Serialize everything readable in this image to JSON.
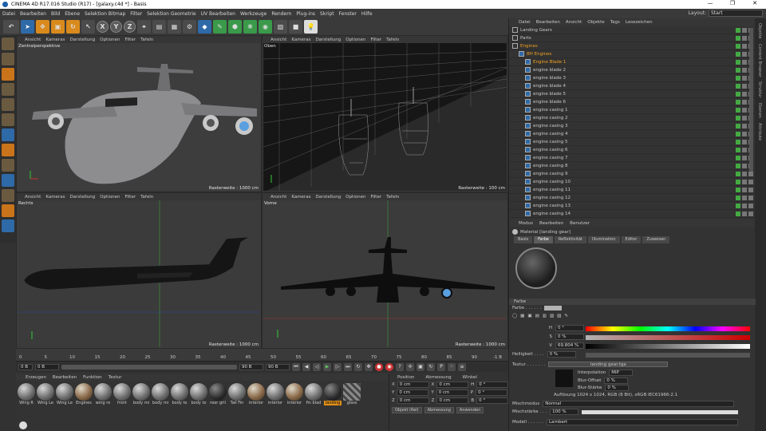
{
  "window": {
    "title": "CINEMA 4D R17.016 Studio (R17) - [galaxy.c4d *] - Basis"
  },
  "menu": [
    "Datei",
    "Bearbeiten",
    "Bild",
    "Ebene",
    "Selektion Bitmap",
    "Filter",
    "Selektion Geometrie",
    "UV Bearbeiten",
    "Werkzeuge",
    "Rendern",
    "Plug-ins",
    "Skript",
    "Fenster",
    "Hilfe"
  ],
  "layout": {
    "label": "Layout:",
    "value": "Start"
  },
  "toolbar": {
    "x": "X",
    "y": "Y",
    "z": "Z"
  },
  "viewport_menu": [
    "Ansicht",
    "Kameras",
    "Darstellung",
    "Optionen",
    "Filter",
    "Tafeln"
  ],
  "viewports": [
    {
      "label": "Zentralperspektive",
      "grid": "Rasterweite : 1000 cm"
    },
    {
      "label": "Oben",
      "grid": "Rasterweite : 100 cm"
    },
    {
      "label": "Rechts",
      "grid": "Rasterweite : 1000 cm"
    },
    {
      "label": "Vorne",
      "grid": "Rasterweite : 1000 cm"
    }
  ],
  "timeline": {
    "ticks": [
      "0",
      "5",
      "10",
      "15",
      "20",
      "25",
      "30",
      "35",
      "40",
      "45",
      "50",
      "55",
      "60",
      "65",
      "70",
      "75",
      "80",
      "85",
      "90"
    ],
    "end": "-1 B"
  },
  "playbar": {
    "start": "0 B",
    "start2": "0 B",
    "end": "90 B",
    "end2": "90 B"
  },
  "material_menu": [
    "Erzeugen",
    "Bearbeiten",
    "Funktion",
    "Textur"
  ],
  "materials": [
    {
      "name": "Wing R",
      "kind": "grey"
    },
    {
      "name": "Wing Le",
      "kind": "grey"
    },
    {
      "name": "Wing Le",
      "kind": "grey"
    },
    {
      "name": "Engines",
      "kind": "tex"
    },
    {
      "name": "wing ro",
      "kind": "grey"
    },
    {
      "name": "front",
      "kind": "grey"
    },
    {
      "name": "body mi",
      "kind": "grey"
    },
    {
      "name": "body mi",
      "kind": "grey"
    },
    {
      "name": "body to",
      "kind": "grey"
    },
    {
      "name": "body to",
      "kind": "grey"
    },
    {
      "name": "rear gril",
      "kind": "dark"
    },
    {
      "name": "Tail Fin",
      "kind": "grey"
    },
    {
      "name": "interior",
      "kind": "tex"
    },
    {
      "name": "interior",
      "kind": "grey"
    },
    {
      "name": "interior",
      "kind": "tex"
    },
    {
      "name": "fin blad",
      "kind": "grey"
    },
    {
      "name": "landing",
      "kind": "dark",
      "selected": true
    },
    {
      "name": "glass",
      "kind": "stripe"
    }
  ],
  "coords": {
    "headers": [
      "Position",
      "Abmessung",
      "Winkel"
    ],
    "rows": [
      [
        "X",
        "0 cm",
        "X",
        "0 cm",
        "H",
        "0 °"
      ],
      [
        "Y",
        "0 cm",
        "Y",
        "0 cm",
        "P",
        "0 °"
      ],
      [
        "Z",
        "0 cm",
        "Z",
        "0 cm",
        "B",
        "0 °"
      ]
    ],
    "mode1": "Objekt (Rel)",
    "mode2": "Abmessung",
    "apply": "Anwenden"
  },
  "object_menu": [
    "Datei",
    "Bearbeiten",
    "Ansicht",
    "Objekte",
    "Tags",
    "Lesezeichen"
  ],
  "objects": [
    {
      "name": "Landing Gears",
      "indent": 0,
      "sel": false
    },
    {
      "name": "Parts",
      "indent": 0,
      "sel": false
    },
    {
      "name": "Engines",
      "indent": 0,
      "sel": true
    },
    {
      "name": "BH Engines",
      "indent": 1,
      "sel": true
    },
    {
      "name": "Engine Blade 1",
      "indent": 2,
      "sel": true
    },
    {
      "name": "engine blade 2",
      "indent": 2,
      "sel": false
    },
    {
      "name": "engine blade 3",
      "indent": 2,
      "sel": false
    },
    {
      "name": "engine blade 4",
      "indent": 2,
      "sel": false
    },
    {
      "name": "engine blade 5",
      "indent": 2,
      "sel": false
    },
    {
      "name": "engine blade 6",
      "indent": 2,
      "sel": false
    },
    {
      "name": "engine casing 1",
      "indent": 2,
      "sel": false
    },
    {
      "name": "engine casing 2",
      "indent": 2,
      "sel": false
    },
    {
      "name": "engine casing 3",
      "indent": 2,
      "sel": false
    },
    {
      "name": "engine casing 4",
      "indent": 2,
      "sel": false
    },
    {
      "name": "engine casing 5",
      "indent": 2,
      "sel": false
    },
    {
      "name": "engine casing 6",
      "indent": 2,
      "sel": false
    },
    {
      "name": "engine casing 7",
      "indent": 2,
      "sel": false
    },
    {
      "name": "engine casing 8",
      "indent": 2,
      "sel": false
    },
    {
      "name": "engine casing 9",
      "indent": 2,
      "sel": false
    },
    {
      "name": "engine casing 10",
      "indent": 2,
      "sel": false
    },
    {
      "name": "engine casing 11",
      "indent": 2,
      "sel": false
    },
    {
      "name": "engine casing 12",
      "indent": 2,
      "sel": false
    },
    {
      "name": "engine casing 13",
      "indent": 2,
      "sel": false
    },
    {
      "name": "engine casing 14",
      "indent": 2,
      "sel": false
    }
  ],
  "attr": {
    "menu": [
      "Modus",
      "Bearbeiten",
      "Benutzer"
    ],
    "title": "Material [landing gear]",
    "tabs": [
      "Basis",
      "Farbe",
      "Reflektivität",
      "Illumination",
      "Editor",
      "Zuweisen"
    ],
    "color_section": "Farbe",
    "color_label": "Farbe . . . . . .",
    "h": "0 °",
    "s": "0 %",
    "v": "69.804 %",
    "brightness_label": "Helligkeit . . . .",
    "brightness": "0 %",
    "texture_label": "Textur . . . . . . .",
    "texture": "landing gear.tga",
    "interp_label": "Interpolation",
    "interp": "MIP",
    "bluroff_label": "Blur-Offset",
    "bluroff": "0 %",
    "blurstr_label": "Blur-Stärke",
    "blurstr": "0 %",
    "res": "Auflösung 1024 x 1024, RGB (8 Bit), sRGB IEC61966-2.1",
    "mix_label": "Mischmodus",
    "mix": "Normal",
    "mixstr_label": "Mischstärke . . .",
    "mixstr": "100 %",
    "model_label": "Modell . . . . . .",
    "model": "Lambert"
  },
  "right_tabs": [
    "Objekte",
    "Content Browser",
    "Struktur",
    "Ebenen",
    "Attribute"
  ]
}
